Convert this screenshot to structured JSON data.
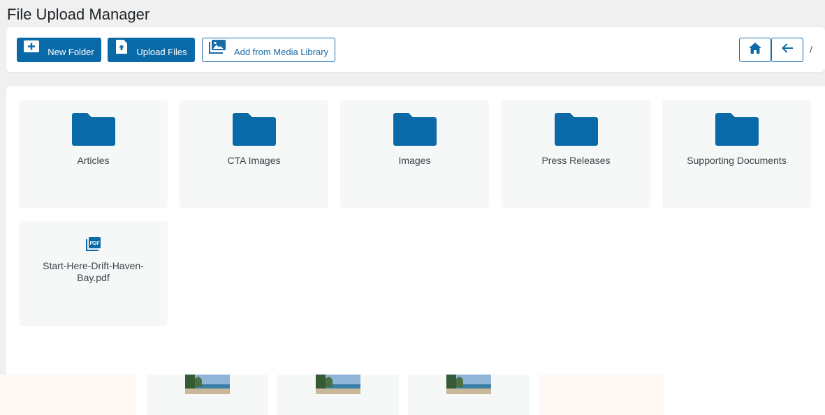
{
  "app": {
    "title": "File Upload Manager"
  },
  "toolbar": {
    "new_folder_label": "New Folder",
    "upload_files_label": "Upload Files",
    "media_library_label": "Add from Media Library",
    "breadcrumb_separator": "/"
  },
  "colors": {
    "primary": "#0a6aa8",
    "folder": "#0a6aa8",
    "background": "#f0f0f1",
    "card": "#f6f7f7"
  },
  "folders": [
    {
      "name": "Articles",
      "icon": "folder-icon"
    },
    {
      "name": "CTA Images",
      "icon": "folder-icon"
    },
    {
      "name": "Images",
      "icon": "folder-icon"
    },
    {
      "name": "Press Releases",
      "icon": "folder-icon"
    },
    {
      "name": "Supporting Documents",
      "icon": "folder-icon"
    }
  ],
  "files": [
    {
      "name": "Start-Here-Drift-Haven-Bay.pdf",
      "icon": "pdf-icon"
    }
  ]
}
